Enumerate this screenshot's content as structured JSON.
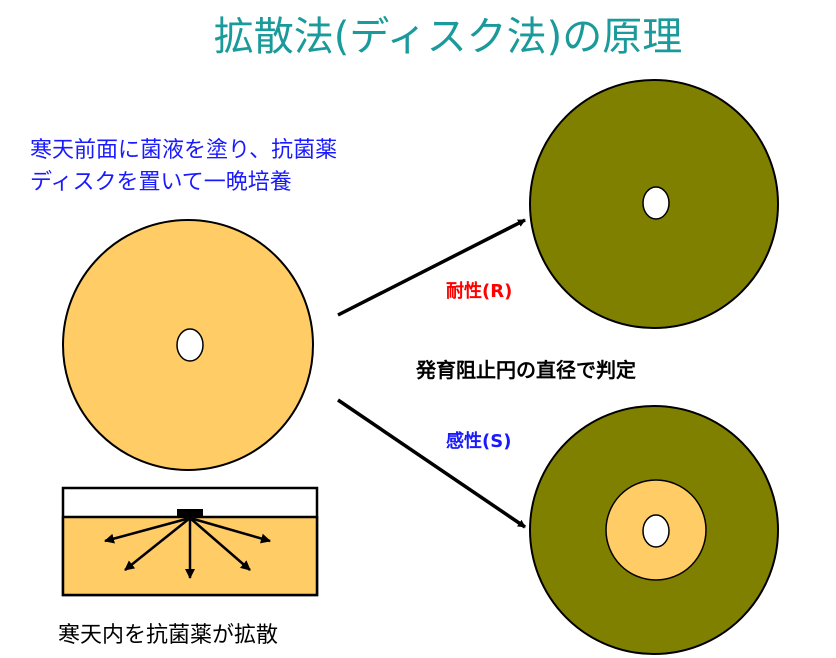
{
  "title": "拡散法(ディスク法)の原理",
  "instruction_lines": [
    "寒天前面に菌液を塗り、抗菌薬",
    "ディスクを置いて一晩培養"
  ],
  "diffusion_caption": "寒天内を抗菌薬が拡散",
  "resistant_label": "耐性(R)",
  "susceptible_label": "感性(S)",
  "judgement_text": "発育阻止円の直径で判定",
  "colors": {
    "title": "#1a9a9a",
    "instruction": "#1a1aff",
    "agar": "#ffcc66",
    "bacterial_growth": "#808000",
    "resistant": "#ff0000",
    "susceptible": "#1a1aff"
  }
}
